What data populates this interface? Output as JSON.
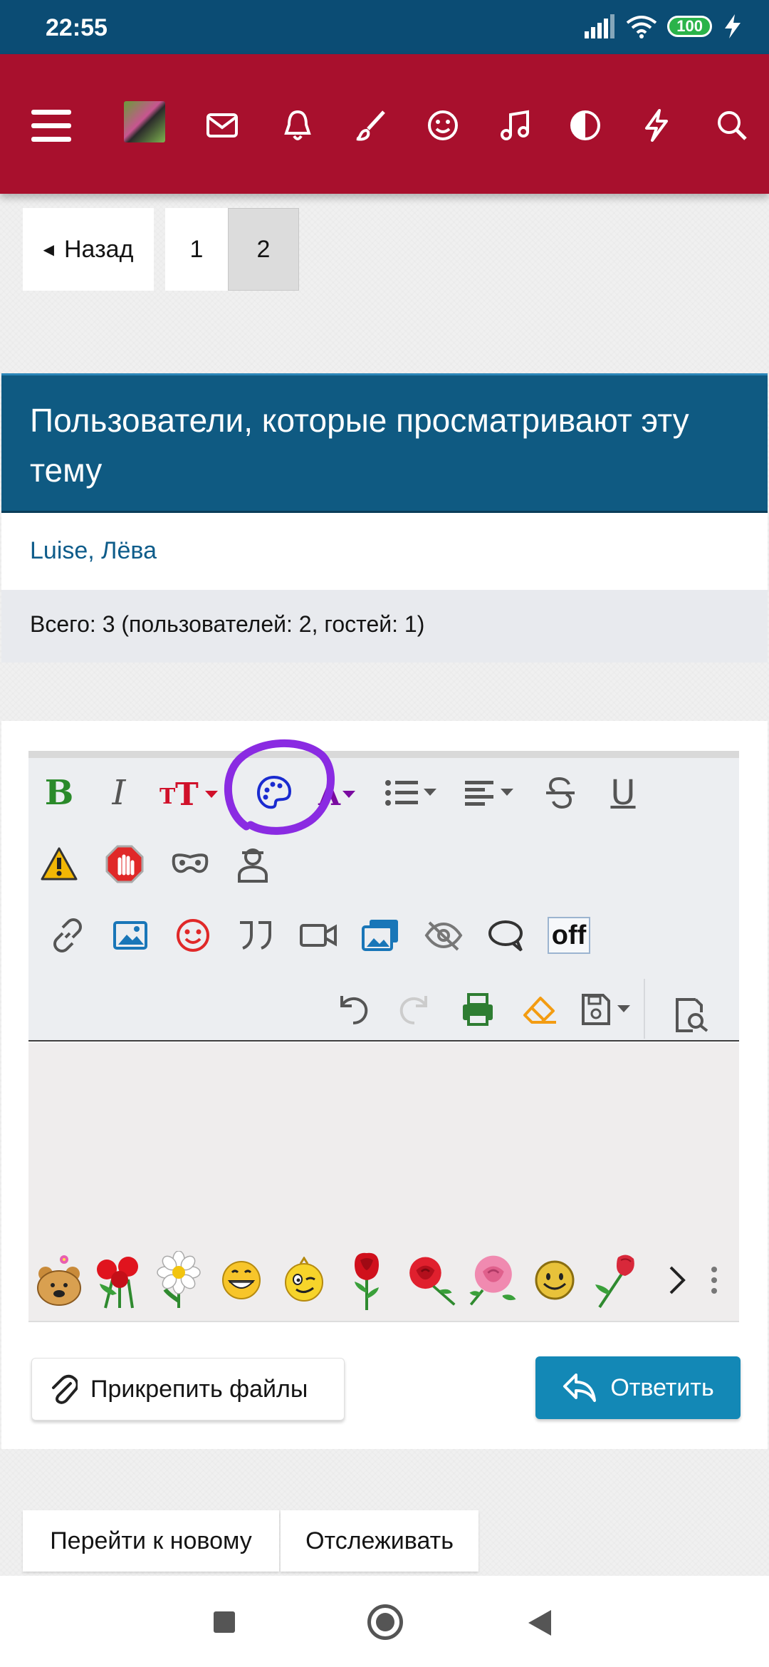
{
  "status_bar": {
    "time": "22:55",
    "battery": "100"
  },
  "top_nav": {
    "icons": [
      "menu-icon",
      "avatar",
      "mail-icon",
      "bell-icon",
      "brush-icon",
      "smile-icon",
      "music-icon",
      "contrast-icon",
      "lightning-icon",
      "search-icon"
    ]
  },
  "pagination": {
    "back_label": "Назад",
    "pages": [
      "1",
      "2"
    ],
    "current": "2"
  },
  "viewers_block": {
    "title": "Пользователи, которые просматривают эту тему",
    "users": "Luise, Лёва",
    "total": "Всего: 3 (пользователей: 2, гостей: 1)"
  },
  "editor": {
    "toolbar_row1": [
      "bold",
      "italic",
      "font-size",
      "color-palette",
      "font-color",
      "list",
      "align",
      "strikethrough",
      "underline"
    ],
    "bold_label": "B",
    "italic_label": "I",
    "underline_label": "U",
    "off_label": "off",
    "smilies": [
      "bear-with-flower",
      "red-flowers",
      "daisy",
      "grin",
      "winking-face",
      "red-rose",
      "rose",
      "pink-rose",
      "smiley",
      "rose-bud"
    ]
  },
  "actions": {
    "attach_label": "Прикрепить файлы",
    "reply_label": "Ответить"
  },
  "bottom_buttons": {
    "go_new": "Перейти к новому",
    "watch": "Отслеживать"
  },
  "colors": {
    "header_red": "#a8102d",
    "block_blue": "#0f5a82",
    "reply_blue": "#1388b6",
    "annotation_purple": "#8a2be2"
  }
}
